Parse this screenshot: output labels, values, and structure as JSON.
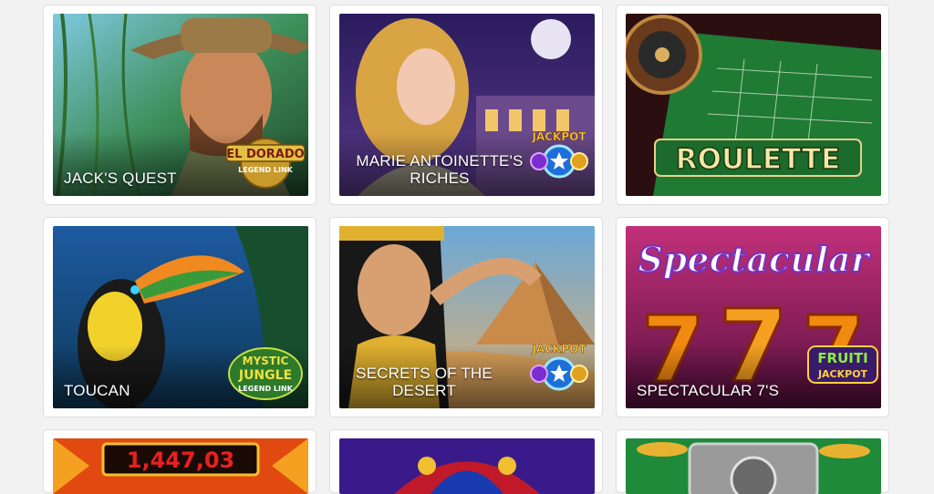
{
  "games": [
    {
      "title": "JACK'S QUEST",
      "badge": "EL DORADO LEGEND LINK"
    },
    {
      "title": "MARIE ANTOINETTE'S RICHES",
      "badge": "JACKPOT"
    },
    {
      "title": "",
      "logo": "ROULETTE"
    },
    {
      "title": "TOUCAN",
      "badge": "MYSTIC JUNGLE LEGEND LINK"
    },
    {
      "title": "SECRETS OF THE DESERT",
      "badge": "JACKPOT"
    },
    {
      "title": "SPECTACULAR 7'S",
      "logo": "Spectacular",
      "badge": "FRUITI JACKPOT"
    },
    {
      "title": "",
      "jackpot_value": "1,447,03"
    },
    {
      "title": ""
    },
    {
      "title": ""
    }
  ],
  "colors": {
    "page_bg": "#f2f2f2",
    "card_border": "#dddddd",
    "jackpot_blue": "#1e6fd9",
    "gold": "#e8b230"
  }
}
